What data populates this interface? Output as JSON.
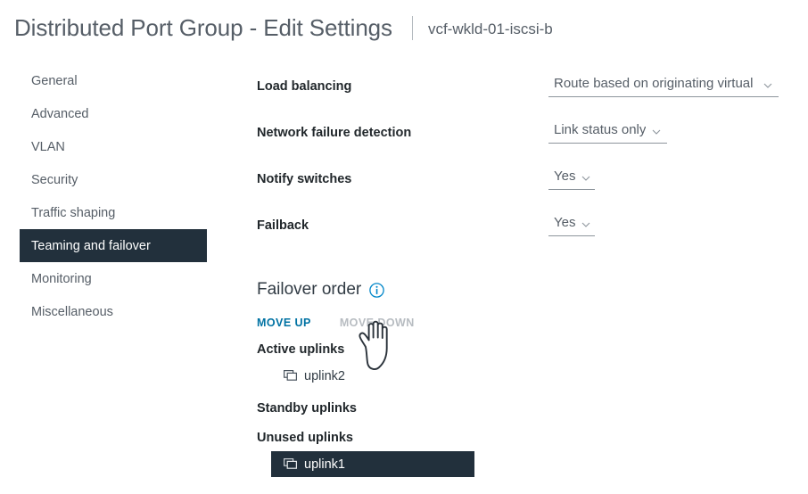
{
  "header": {
    "title": "Distributed Port Group - Edit Settings",
    "subtitle": "vcf-wkld-01-iscsi-b"
  },
  "sidebar": {
    "items": [
      {
        "label": "General",
        "selected": false
      },
      {
        "label": "Advanced",
        "selected": false
      },
      {
        "label": "VLAN",
        "selected": false
      },
      {
        "label": "Security",
        "selected": false
      },
      {
        "label": "Traffic shaping",
        "selected": false
      },
      {
        "label": "Teaming and failover",
        "selected": true
      },
      {
        "label": "Monitoring",
        "selected": false
      },
      {
        "label": "Miscellaneous",
        "selected": false
      }
    ]
  },
  "form": {
    "rows": [
      {
        "label": "Load balancing",
        "value": "Route based on originating virtual por"
      },
      {
        "label": "Network failure detection",
        "value": "Link status only"
      },
      {
        "label": "Notify switches",
        "value": "Yes"
      },
      {
        "label": "Failback",
        "value": "Yes"
      }
    ]
  },
  "failover": {
    "heading": "Failover order",
    "info_icon": "info-circle-icon",
    "move_up_label": "MOVE UP",
    "move_down_label": "MOVE DOWN",
    "move_up_enabled": true,
    "move_down_enabled": false,
    "groups": [
      {
        "label": "Active uplinks",
        "uplinks": [
          {
            "name": "uplink2",
            "icon": "network-adapter-icon",
            "selected": false
          }
        ]
      },
      {
        "label": "Standby uplinks",
        "uplinks": []
      },
      {
        "label": "Unused uplinks",
        "uplinks": [
          {
            "name": "uplink1",
            "icon": "network-adapter-icon",
            "selected": true
          }
        ]
      }
    ]
  },
  "cursor": {
    "icon": "pointing-hand-cursor"
  },
  "colors": {
    "accent": "#0072a3",
    "selected_bg": "#22303c",
    "label": "#21272b",
    "muted": "#565e67",
    "disabled": "#b7bcc1"
  }
}
